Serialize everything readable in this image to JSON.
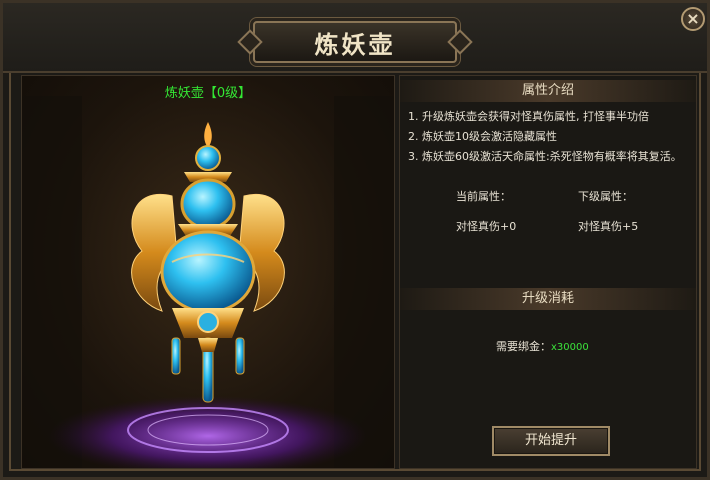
{
  "window": {
    "title": "炼妖壶",
    "close_icon": "×"
  },
  "item": {
    "name": "炼妖壶【0级】"
  },
  "attributes": {
    "header": "属性介绍",
    "descriptions": [
      "1. 升级炼妖壶会获得对怪真伤属性, 打怪事半功倍",
      "2. 炼妖壶10级会激活隐藏属性",
      "3. 炼妖壶60级激活天命属性:杀死怪物有概率将其复活。"
    ],
    "current_label": "当前属性：",
    "next_label": "下级属性：",
    "current_value": "对怪真伤+0",
    "next_value": "对怪真伤+5"
  },
  "upgrade": {
    "header": "升级消耗",
    "cost_label": "需要绑金：",
    "cost_value": "x30000",
    "button_label": "开始提升"
  },
  "colors": {
    "item_name": "#34e834",
    "cost_value": "#3be23b",
    "border": "#5a4a34"
  }
}
